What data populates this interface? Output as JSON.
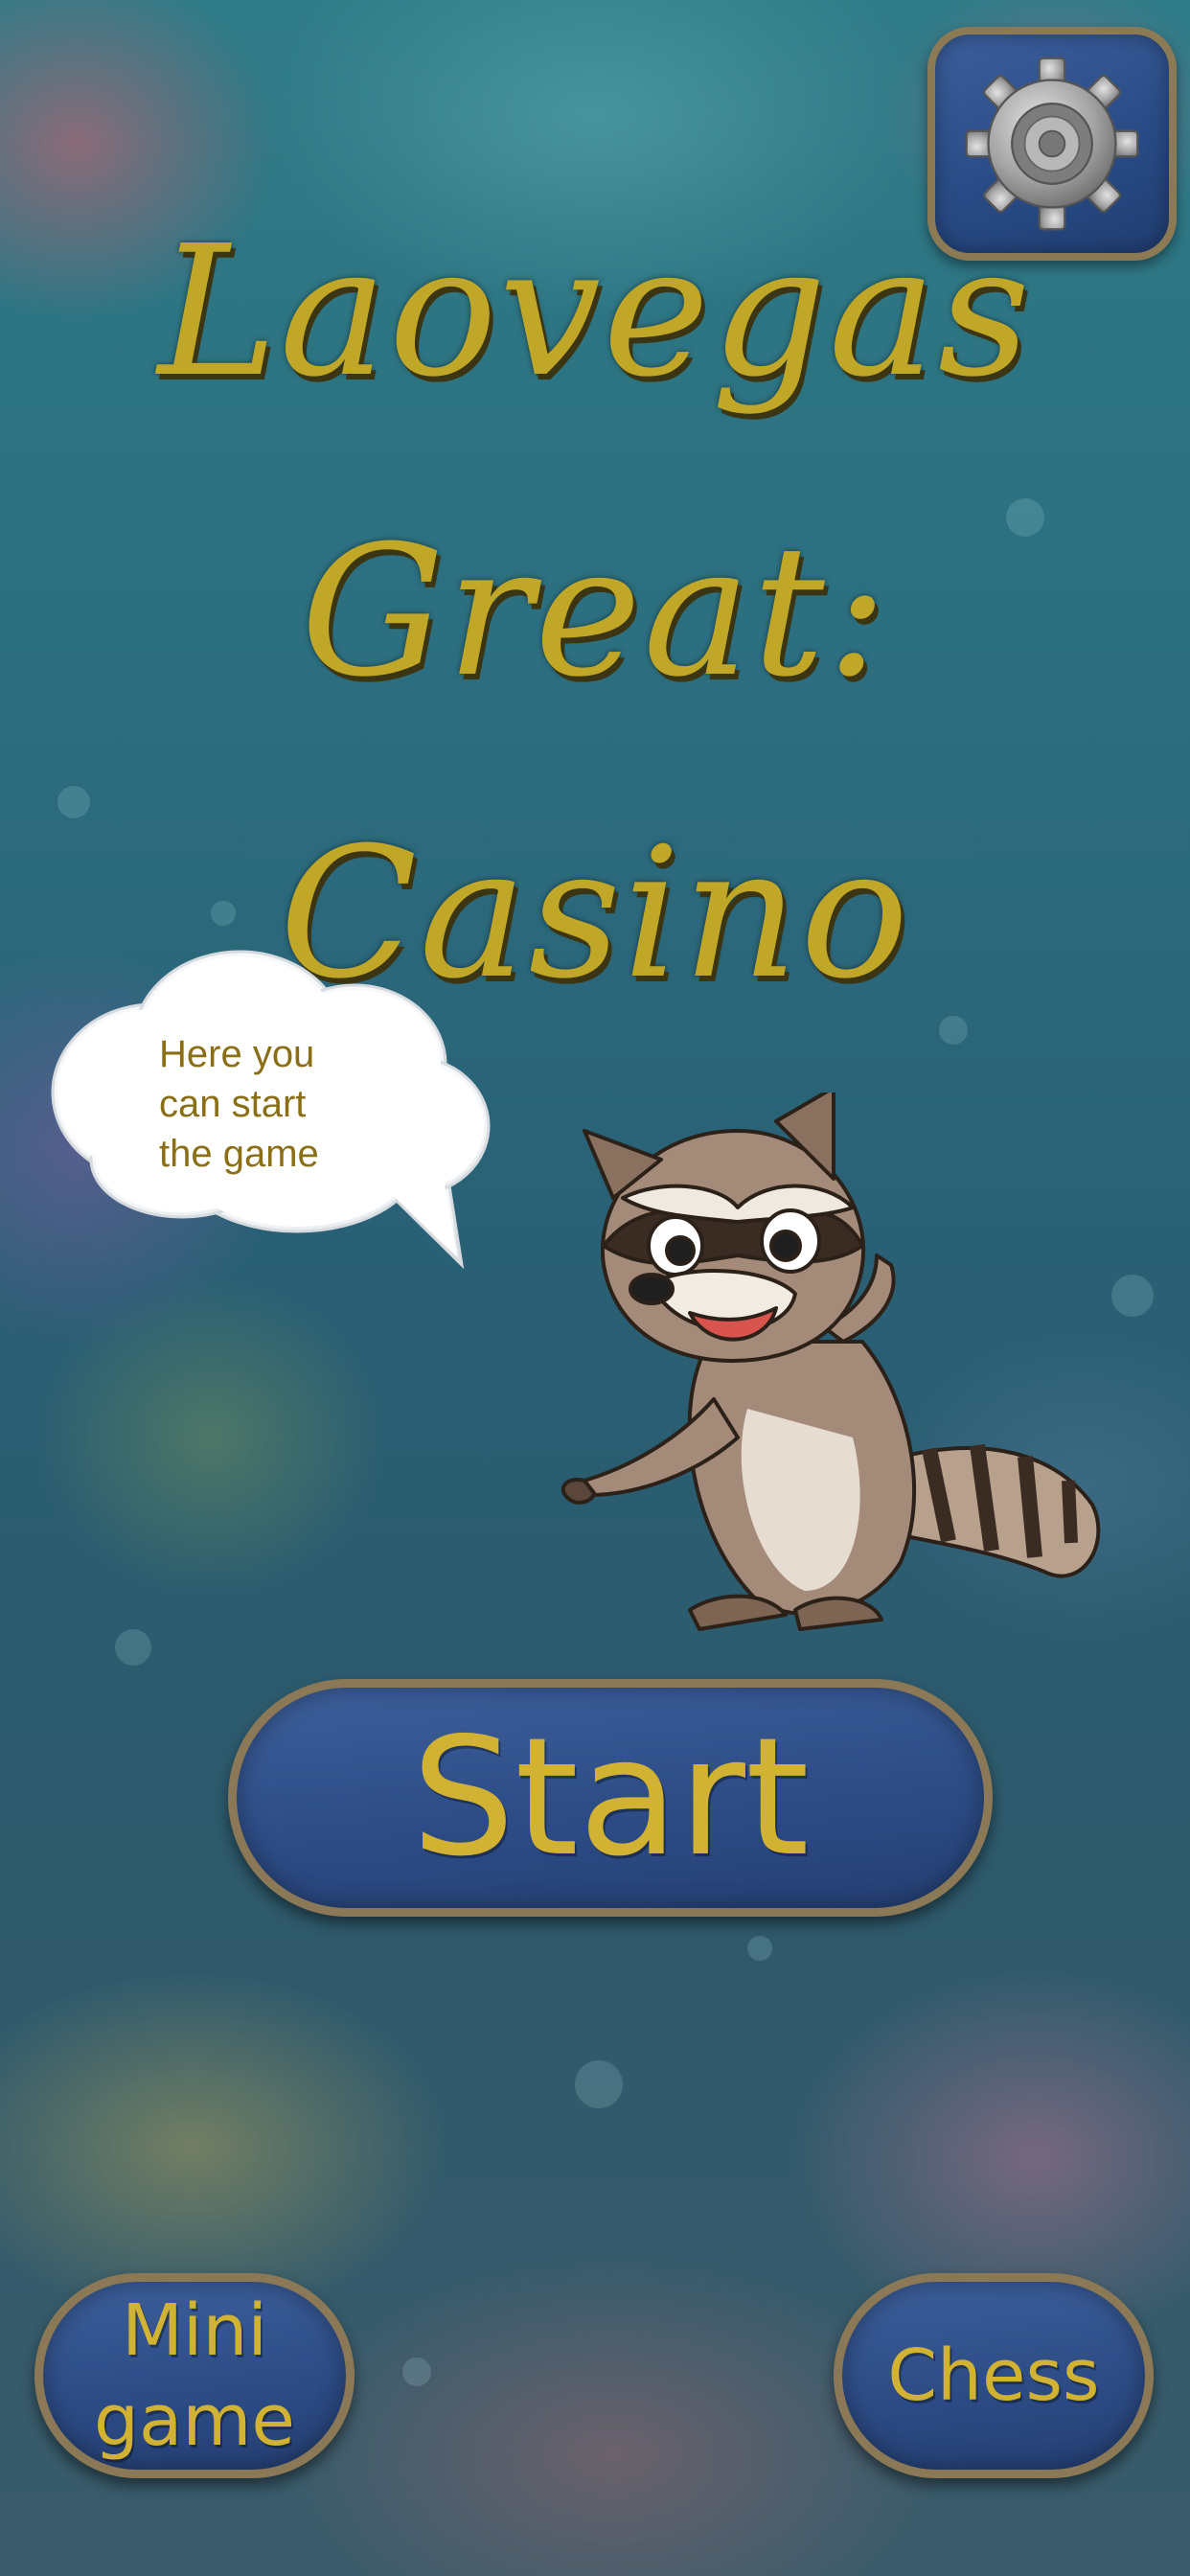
{
  "title": {
    "line1": "Laovegas",
    "line2": "Great:",
    "line3": "Casino"
  },
  "speech_bubble": {
    "text": "Here you\ncan start\nthe game"
  },
  "buttons": {
    "start": "Start",
    "mini_game": "Mini\ngame",
    "chess": "Chess"
  },
  "icons": {
    "settings": "gear-icon",
    "mascot": "raccoon-mascot"
  },
  "colors": {
    "title": "#c1a728",
    "button_fill": "#2d4c86",
    "button_border": "#8a7856",
    "button_text": "#d2b233",
    "bubble_text": "#8a6f16"
  }
}
